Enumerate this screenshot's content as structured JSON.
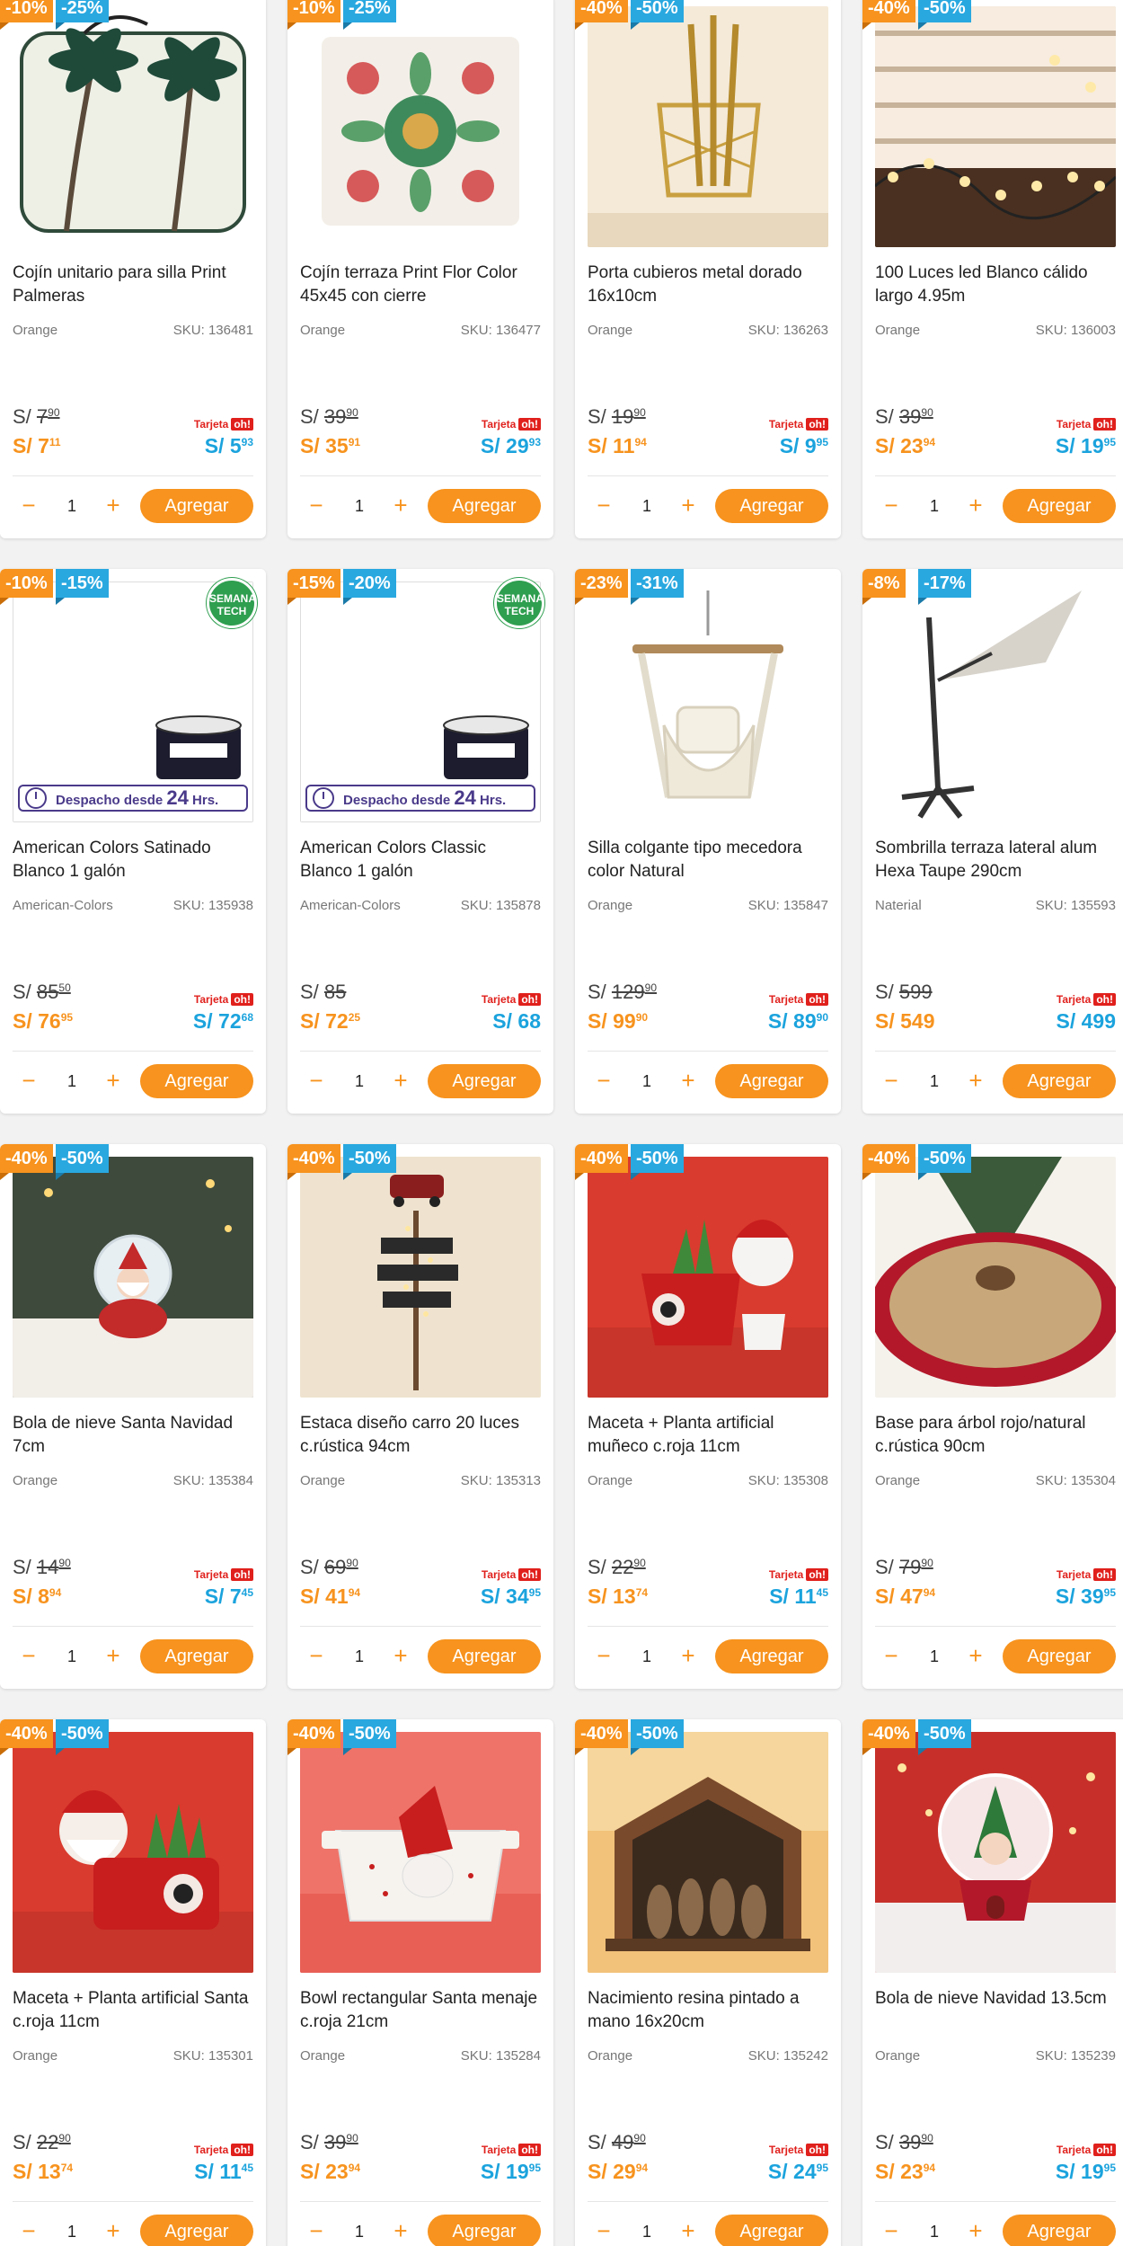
{
  "labels": {
    "currency": "S/",
    "tarjeta": "Tarjeta",
    "oh": "oh!",
    "add": "Agregar",
    "sku_prefix": "SKU:",
    "semana_tech": "SEMANA TECH",
    "despacho": "Despacho desde",
    "despacho_big": "24",
    "despacho_hrs": "Hrs."
  },
  "colors": {
    "orange": "#f7931e",
    "blue": "#29a8e0",
    "green": "#2e9e4f",
    "red": "#e0201c"
  },
  "products": [
    {
      "name": "Cojín unitario para silla Print Palmeras",
      "brand": "Orange",
      "sku": "SKU: 136481",
      "d1": "-10%",
      "d2": "-25%",
      "old": "7",
      "old_dec": "90",
      "now": "S/ 7",
      "now_dec": "11",
      "card": "S/ 5",
      "card_dec": "93",
      "qty": "1",
      "img": "palms"
    },
    {
      "name": "Cojín terraza Print Flor Color 45x45 con cierre",
      "brand": "Orange",
      "sku": "SKU: 136477",
      "d1": "-10%",
      "d2": "-25%",
      "old": "39",
      "old_dec": "90",
      "now": "S/ 35",
      "now_dec": "91",
      "card": "S/ 29",
      "card_dec": "93",
      "qty": "1",
      "img": "flower"
    },
    {
      "name": "Porta cubieros metal dorado 16x10cm",
      "brand": "Orange",
      "sku": "SKU: 136263",
      "d1": "-40%",
      "d2": "-50%",
      "old": "19",
      "old_dec": "90",
      "now": "S/ 11",
      "now_dec": "94",
      "card": "S/ 9",
      "card_dec": "95",
      "qty": "1",
      "img": "cutlery"
    },
    {
      "name": "100 Luces led Blanco cálido largo 4.95m",
      "brand": "Orange",
      "sku": "SKU: 136003",
      "d1": "-40%",
      "d2": "-50%",
      "old": "39",
      "old_dec": "90",
      "now": "S/ 23",
      "now_dec": "94",
      "card": "S/ 19",
      "card_dec": "95",
      "qty": "1",
      "img": "lights"
    },
    {
      "name": "American Colors Satinado Blanco 1 galón",
      "brand": "American-Colors",
      "sku": "SKU: 135938",
      "d1": "-10%",
      "d2": "-15%",
      "old": "85",
      "old_dec": "50",
      "now": "S/ 76",
      "now_dec": "95",
      "card": "S/ 72",
      "card_dec": "68",
      "qty": "1",
      "img": "paint",
      "semana": true
    },
    {
      "name": "American Colors Classic Blanco 1 galón",
      "brand": "American-Colors",
      "sku": "SKU: 135878",
      "d1": "-15%",
      "d2": "-20%",
      "old": "85",
      "old_dec": "",
      "now": "S/ 72",
      "now_dec": "25",
      "card": "S/ 68",
      "card_dec": "",
      "qty": "1",
      "img": "paint",
      "semana": true
    },
    {
      "name": "Silla colgante tipo mecedora color Natural",
      "brand": "Orange",
      "sku": "SKU: 135847",
      "d1": "-23%",
      "d2": "-31%",
      "old": "129",
      "old_dec": "90",
      "now": "S/ 99",
      "now_dec": "90",
      "card": "S/ 89",
      "card_dec": "90",
      "qty": "1",
      "img": "hammock"
    },
    {
      "name": "Sombrilla terraza lateral alum Hexa Taupe 290cm",
      "brand": "Naterial",
      "sku": "SKU: 135593",
      "d1": "-8%",
      "d2": "-17%",
      "old": "599",
      "old_dec": "",
      "now": "S/ 549",
      "now_dec": "",
      "card": "S/ 499",
      "card_dec": "",
      "qty": "1",
      "img": "umbrella"
    },
    {
      "name": "Bola de nieve Santa Navidad 7cm",
      "brand": "Orange",
      "sku": "SKU: 135384",
      "d1": "-40%",
      "d2": "-50%",
      "old": "14",
      "old_dec": "90",
      "now": "S/ 8",
      "now_dec": "94",
      "card": "S/ 7",
      "card_dec": "45",
      "qty": "1",
      "img": "snowglobe"
    },
    {
      "name": "Estaca diseño carro 20 luces c.rústica 94cm",
      "brand": "Orange",
      "sku": "SKU: 135313",
      "d1": "-40%",
      "d2": "-50%",
      "old": "69",
      "old_dec": "90",
      "now": "S/ 41",
      "now_dec": "94",
      "card": "S/ 34",
      "card_dec": "95",
      "qty": "1",
      "img": "stake"
    },
    {
      "name": "Maceta + Planta artificial muñeco c.roja 11cm",
      "brand": "Orange",
      "sku": "SKU: 135308",
      "d1": "-40%",
      "d2": "-50%",
      "old": "22",
      "old_dec": "90",
      "now": "S/ 13",
      "now_dec": "74",
      "card": "S/ 11",
      "card_dec": "45",
      "qty": "1",
      "img": "pot_snowman"
    },
    {
      "name": "Base para árbol rojo/natural c.rústica 90cm",
      "brand": "Orange",
      "sku": "SKU: 135304",
      "d1": "-40%",
      "d2": "-50%",
      "old": "79",
      "old_dec": "90",
      "now": "S/ 47",
      "now_dec": "94",
      "card": "S/ 39",
      "card_dec": "95",
      "qty": "1",
      "img": "treeskirt"
    },
    {
      "name": "Maceta + Planta artificial Santa c.roja 11cm",
      "brand": "Orange",
      "sku": "SKU: 135301",
      "d1": "-40%",
      "d2": "-50%",
      "old": "22",
      "old_dec": "90",
      "now": "S/ 13",
      "now_dec": "74",
      "card": "S/ 11",
      "card_dec": "45",
      "qty": "1",
      "img": "pot_santa"
    },
    {
      "name": "Bowl rectangular Santa menaje c.roja 21cm",
      "brand": "Orange",
      "sku": "SKU: 135284",
      "d1": "-40%",
      "d2": "-50%",
      "old": "39",
      "old_dec": "90",
      "now": "S/ 23",
      "now_dec": "94",
      "card": "S/ 19",
      "card_dec": "95",
      "qty": "1",
      "img": "bowl"
    },
    {
      "name": "Nacimiento resina pintado a mano 16x20cm",
      "brand": "Orange",
      "sku": "SKU: 135242",
      "d1": "-40%",
      "d2": "-50%",
      "old": "49",
      "old_dec": "90",
      "now": "S/ 29",
      "now_dec": "94",
      "card": "S/ 24",
      "card_dec": "95",
      "qty": "1",
      "img": "nativity"
    },
    {
      "name": "Bola de nieve Navidad 13.5cm",
      "brand": "Orange",
      "sku": "SKU: 135239",
      "d1": "-40%",
      "d2": "-50%",
      "old": "39",
      "old_dec": "90",
      "now": "S/ 23",
      "now_dec": "94",
      "card": "S/ 19",
      "card_dec": "95",
      "qty": "1",
      "img": "snowglobe2"
    }
  ]
}
